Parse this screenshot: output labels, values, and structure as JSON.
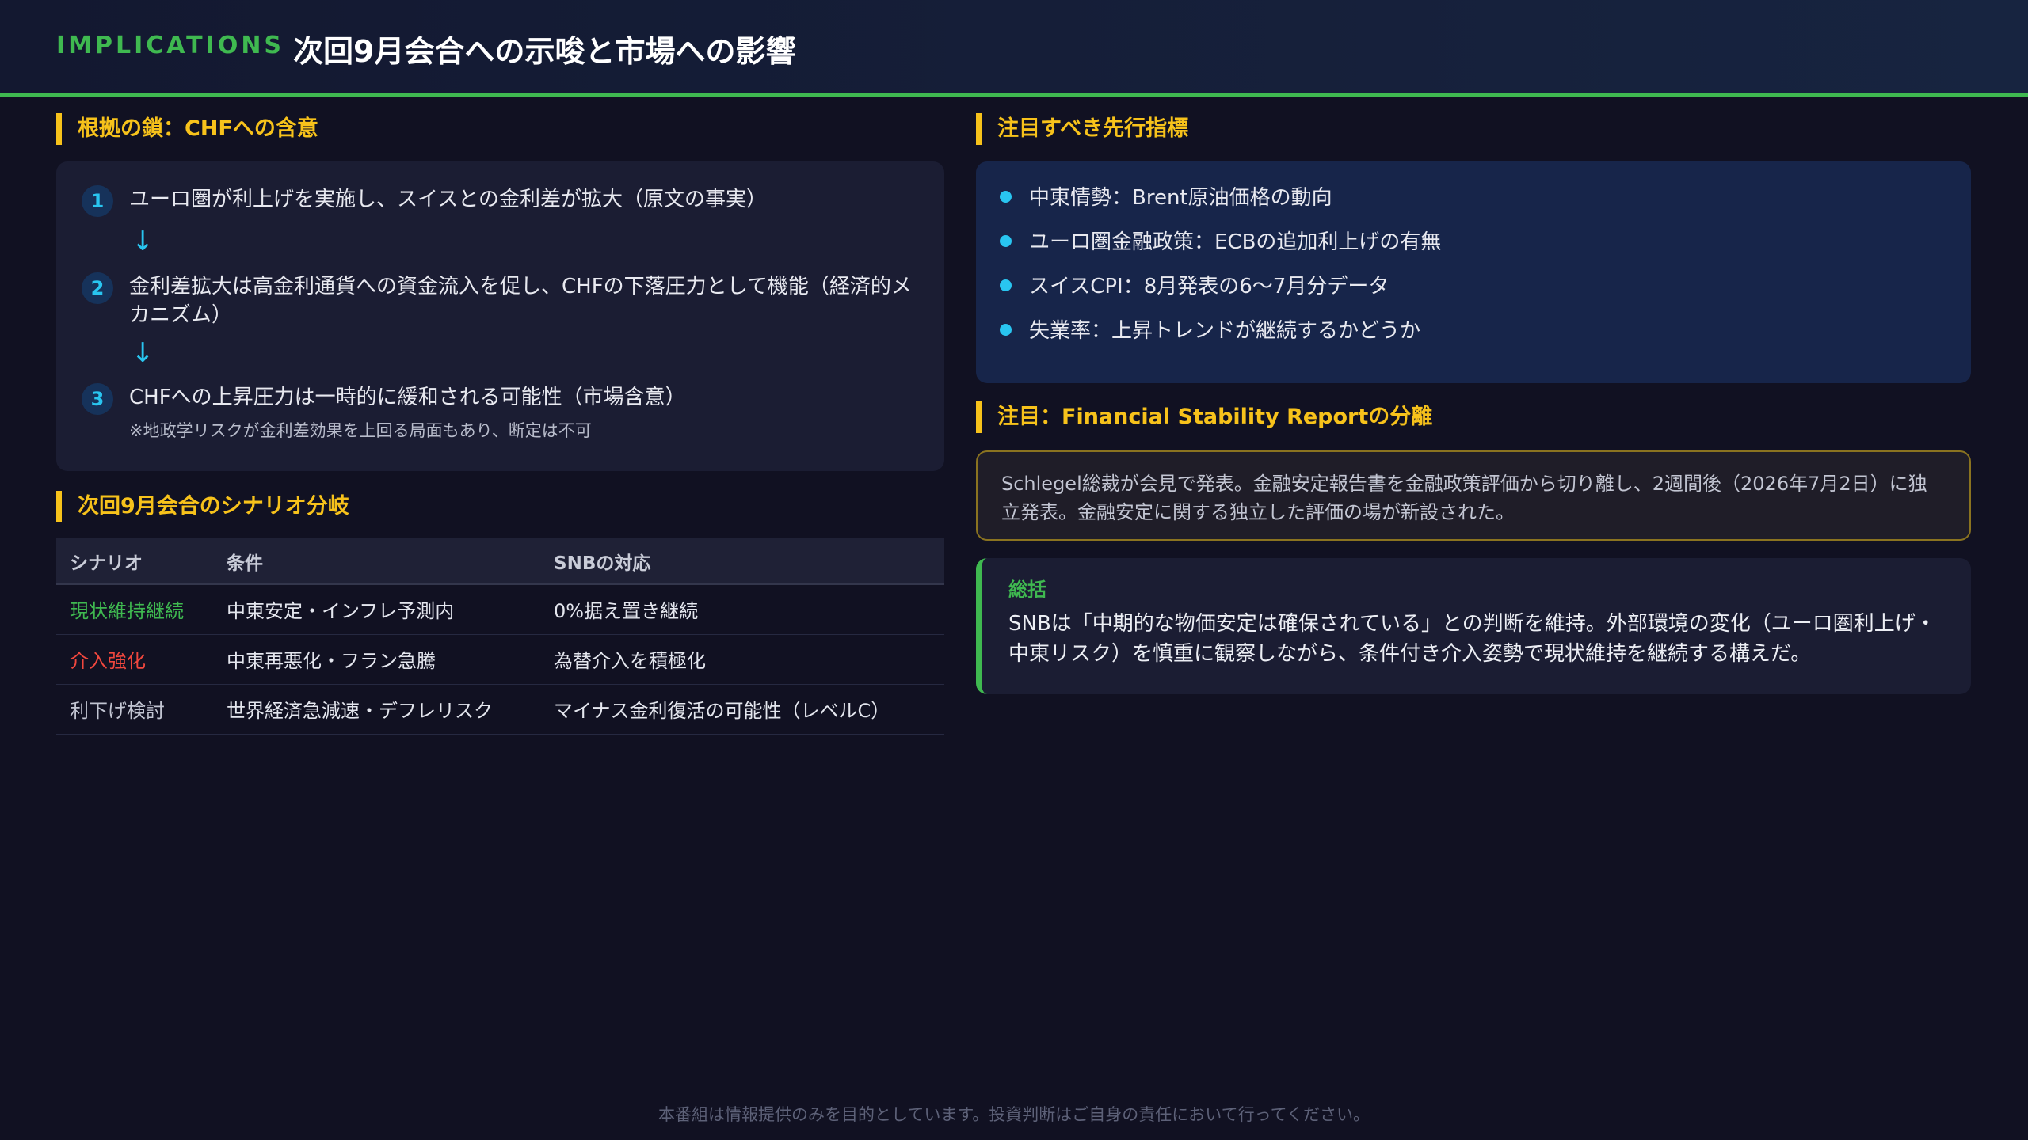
{
  "header": {
    "kicker": "IMPLICATIONS",
    "title": "次回9月会合への示唆と市場への影響"
  },
  "chain": {
    "heading": "根拠の鎖：CHFへの含意",
    "steps": [
      {
        "num": "1",
        "text": "ユーロ圏が利上げを実施し、スイスとの金利差が拡大（原文の事実）"
      },
      {
        "num": "2",
        "text": "金利差拡大は高金利通貨への資金流入を促し、CHFの下落圧力として機能（経済的メカニズム）"
      },
      {
        "num": "3",
        "text": "CHFへの上昇圧力は一時的に緩和される可能性（市場含意）",
        "note": "※地政学リスクが金利差効果を上回る局面もあり、断定は不可"
      }
    ],
    "arrow": "↓"
  },
  "scenarios": {
    "heading": "次回9月会合のシナリオ分岐",
    "columns": [
      "シナリオ",
      "条件",
      "SNBの対応"
    ],
    "rows": [
      {
        "name": "現状維持継続",
        "condition": "中東安定・インフレ予測内",
        "response": "0%据え置き継続",
        "color": "#3fb950"
      },
      {
        "name": "介入強化",
        "condition": "中東再悪化・フラン急騰",
        "response": "為替介入を積極化",
        "color": "#f0473e"
      },
      {
        "name": "利下げ検討",
        "condition": "世界経済急減速・デフレリスク",
        "response": "マイナス金利復活の可能性（レベルC）",
        "color": "#c2c5d2"
      }
    ]
  },
  "indicators": {
    "heading": "注目すべき先行指標",
    "items": [
      "中東情勢：Brent原油価格の動向",
      "ユーロ圏金融政策：ECBの追加利上げの有無",
      "スイスCPI：8月発表の6〜7月分データ",
      "失業率：上昇トレンドが継続するかどうか"
    ]
  },
  "notice": {
    "heading": "注目：Financial Stability Reportの分離",
    "text": "Schlegel総裁が会見で発表。金融安定報告書を金融政策評価から切り離し、2週間後（2026年7月2日）に独立発表。金融安定に関する独立した評価の場が新設された。"
  },
  "summary": {
    "title": "総括",
    "text": "SNBは「中期的な物価安定は確保されている」との判断を維持。外部環境の変化（ユーロ圏利上げ・中東リスク）を慎重に観察しながら、条件付き介入姿勢で現状維持を継続する構えだ。"
  },
  "footer": "本番組は情報提供のみを目的としています。投資判断はご自身の責任において行ってください。",
  "colors": {
    "accent_green": "#3fb950",
    "accent_yellow": "#f7c21b",
    "accent_cyan": "#29c5f0",
    "alert_red": "#f0473e"
  }
}
